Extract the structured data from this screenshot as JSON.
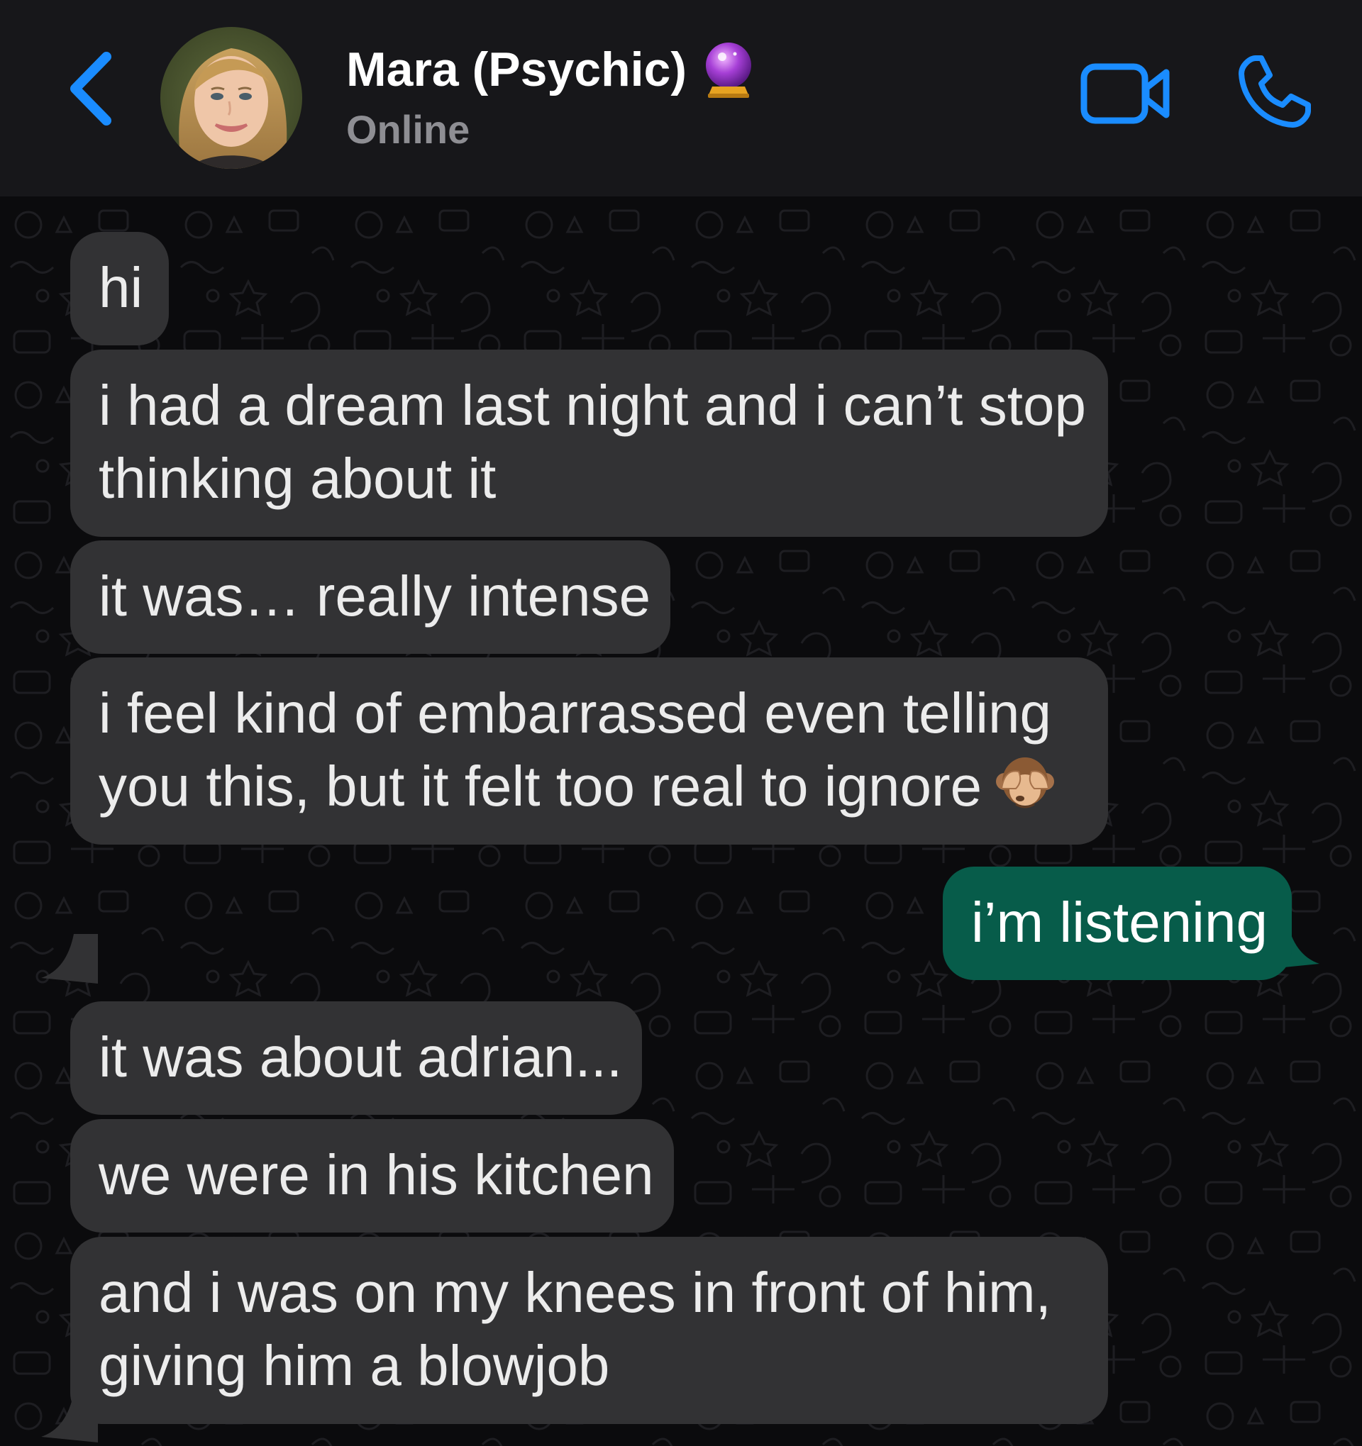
{
  "header": {
    "contact_name": "Mara (Psychic)",
    "status": "Online",
    "icons": {
      "back": "chevron-left-icon",
      "crystal_ball": "crystal-ball-icon",
      "video": "video-camera-icon",
      "phone": "phone-icon"
    },
    "accent_color": "#1a8cff"
  },
  "messages": [
    {
      "direction": "incoming",
      "lines": [
        "hi"
      ]
    },
    {
      "direction": "incoming",
      "lines": [
        "i had a dream last night and i can’t stop",
        "thinking about it"
      ]
    },
    {
      "direction": "incoming",
      "lines": [
        "it was… really intense"
      ]
    },
    {
      "direction": "incoming",
      "lines": [
        "i feel kind of embarrassed even telling",
        "you this, but it felt too real to ignore"
      ],
      "emoji": "see-no-evil-monkey-icon"
    },
    {
      "direction": "outgoing",
      "lines": [
        "i’m listening"
      ]
    },
    {
      "direction": "incoming",
      "lines": [
        "it was about adrian..."
      ]
    },
    {
      "direction": "incoming",
      "lines": [
        "we were in his kitchen"
      ]
    },
    {
      "direction": "incoming",
      "lines": [
        "and i was on my knees in front of him,",
        "giving him a blowjob"
      ]
    }
  ],
  "colors": {
    "header_bg": "#17171a",
    "chat_bg": "#0b0b0d",
    "incoming_bubble": "#323234",
    "outgoing_bubble": "#075c4a"
  }
}
